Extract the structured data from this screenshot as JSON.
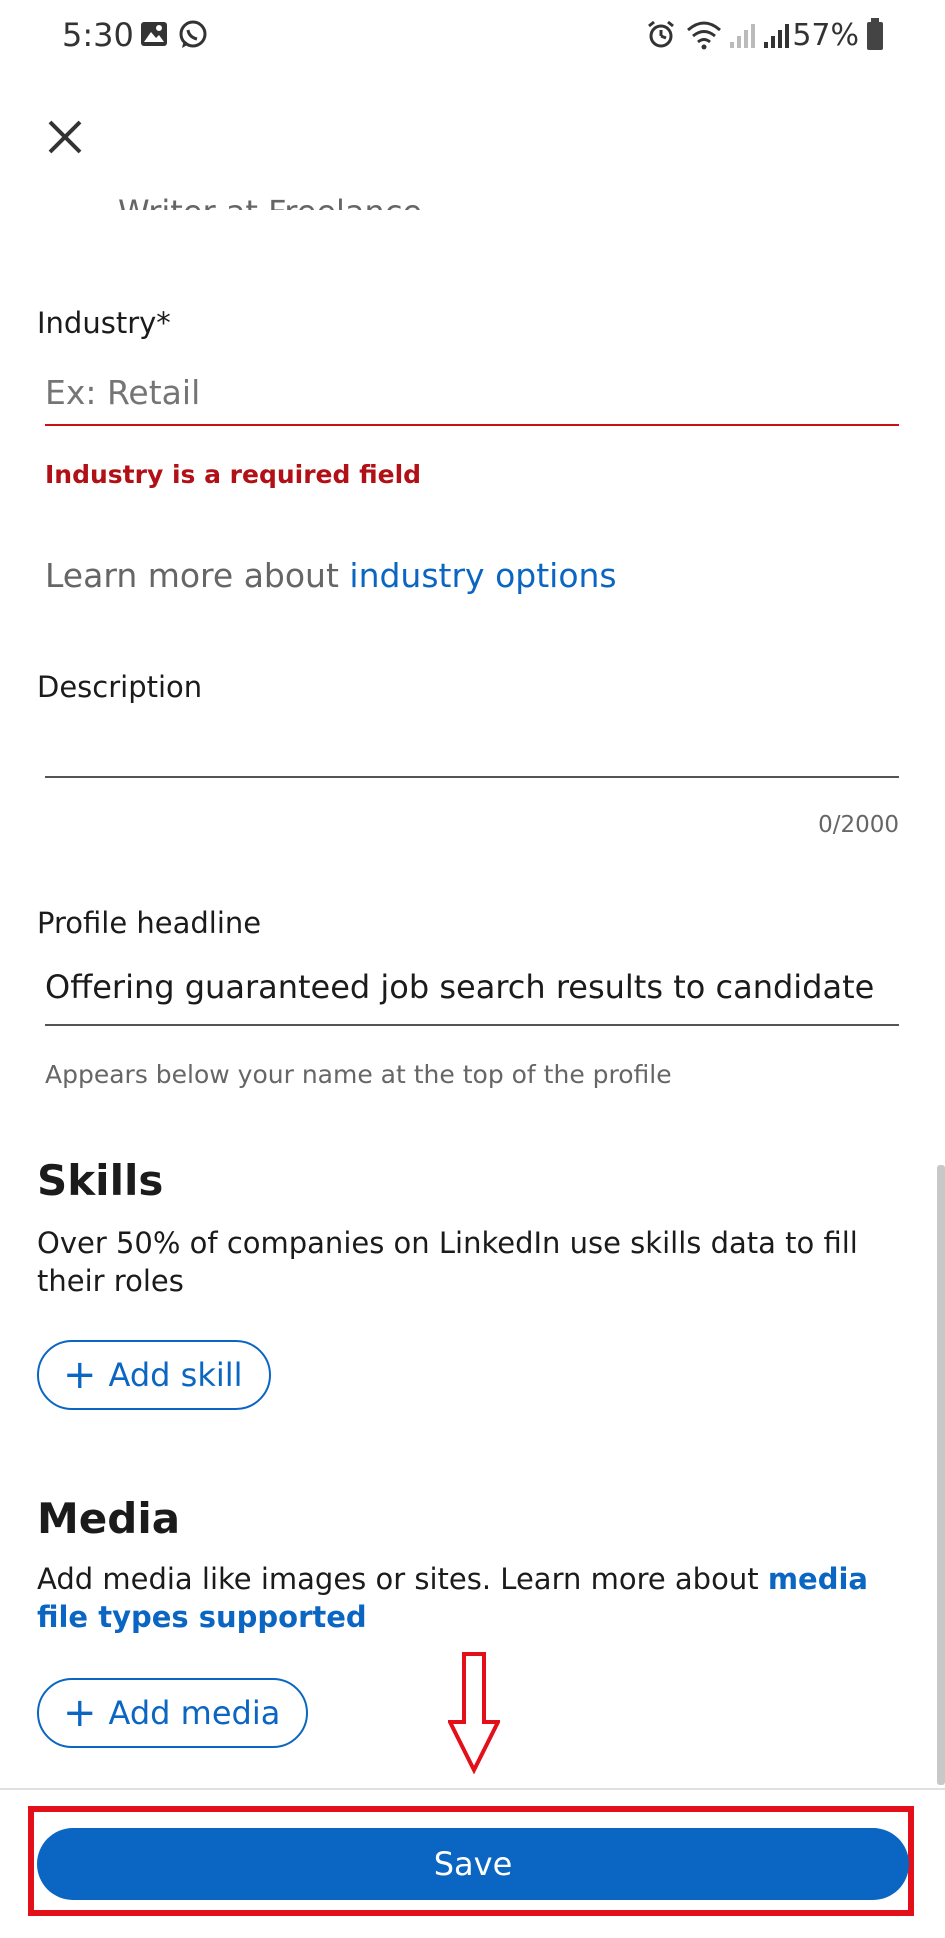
{
  "status_bar": {
    "time": "5:30",
    "battery_percent": "57%",
    "icons": [
      "image-icon",
      "whatsapp-icon",
      "alarm-icon",
      "wifi-icon",
      "signal-icon",
      "signal-icon",
      "battery-icon"
    ]
  },
  "header": {
    "close_icon": "close-icon",
    "clipped_text": "Writer at Freelance"
  },
  "industry": {
    "label": "Industry*",
    "placeholder": "Ex: Retail",
    "value": "",
    "error": "Industry is a required field",
    "learn_more_prefix": "Learn more about ",
    "learn_more_link": "industry options"
  },
  "description": {
    "label": "Description",
    "value": "",
    "counter": "0/2000"
  },
  "profile_headline": {
    "label": "Profile headline",
    "value": "Offering guaranteed job search results to candidate",
    "helper": "Appears below your name at the top of the profile"
  },
  "skills": {
    "title": "Skills",
    "description": "Over 50% of companies on LinkedIn use skills data to fill their roles",
    "button_label": "Add skill"
  },
  "media": {
    "title": "Media",
    "description_prefix": "Add media like images or sites. Learn more about ",
    "description_link": "media file types supported",
    "button_label": "Add media"
  },
  "footer": {
    "save_label": "Save"
  },
  "colors": {
    "accent": "#0a66c2",
    "error": "#cc1016",
    "annotation": "#e3101a"
  }
}
